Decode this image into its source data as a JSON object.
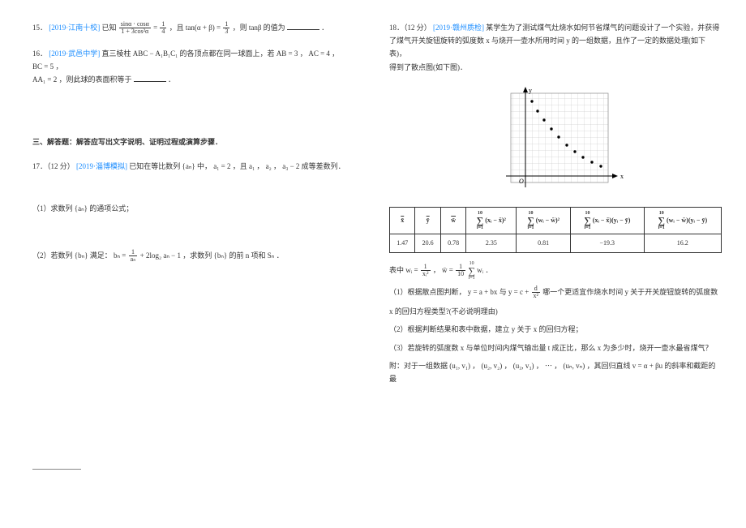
{
  "left": {
    "q15": {
      "num": "15．",
      "src": "[2019·江南十校]",
      "a": "已知 ",
      "frac_n": "sinα · cosα",
      "frac_d": "1 + 3cos²α",
      "eqA": " = ",
      "oneqA_n": "1",
      "oneqA_d": "4",
      "mid": " ，且 tan(α + β) = ",
      "oneqB_n": "1",
      "oneqB_d": "3",
      "tail": " ，则 tanβ 的值为",
      "end": "．"
    },
    "q16": {
      "num": "16．",
      "src": "[2019·武邑中学]",
      "a": "直三棱柱 ABC − A₁B₁C₁ 的各顶点都在同一球面上，若 AB = 3 ， AC = 4 ， BC = 5 ，",
      "b": "AA₁ = 2 ，则此球的表面积等于",
      "end": "．"
    },
    "section": "三、解答题：解答应写出文字说明、证明过程或演算步骤．",
    "q17": {
      "num": "17．（12 分）",
      "src": "[2019·淄博模拟]",
      "a": "已知在等比数列 {aₙ} 中， a₁ = 2 ，且 a₁ ， a₂ ， a₃ − 2 成等差数列．",
      "p1": "（1）求数列 {aₙ} 的通项公式；",
      "p2a": "（2）若数列 {bₙ} 满足： bₙ = ",
      "p2_n": "1",
      "p2_d": "aₙ",
      "p2b": " + 2log₂ aₙ − 1 ，求数列 {bₙ} 的前 n 项和 Sₙ ．"
    }
  },
  "right": {
    "q18": {
      "num": "18．（12 分）",
      "src": "[2019·赣州质检]",
      "a": "某学生为了测试煤气灶烧水如何节省煤气的问题设计了一个实验，并获得",
      "b": "了煤气开关旋钮旋转的弧度数 x 与烧开一壶水所用时间 y 的一组数据，且作了一定的数据处理(如下表)，",
      "c": "得到了散点图(如下图)．",
      "axis_x": "x",
      "axis_y": "y",
      "note_a": "表中 wᵢ = ",
      "note_f1n": "1",
      "note_f1d": "xᵢ²",
      "note_mid": " ，  w̄ = ",
      "note_f2n": "1",
      "note_f2d": "10",
      "note_sum_top": "10",
      "note_sum_bot": "i=1",
      "note_b": " wᵢ ．",
      "p1": "（1）根据散点图判断， y = a + bx 与 y = c + ",
      "p1_fn": "d",
      "p1_fd": "x²",
      "p1b": " 哪一个更适宜作烧水时间 y 关于开关旋钮旋转的弧度数",
      "p1c": "x 的回归方程类型?(不必说明理由)",
      "p2": "（2）根据判断结果和表中数据，建立 y 关于 x 的回归方程；",
      "p3": "（3）若旋转的弧度数 x 与单位时间内煤气输出量 t 成正比，那么 x 为多少时，烧开一壶水最省煤气？",
      "app": "附：对于一组数据 (u₁, v₁) ， (u₂, v₂) ， (u₃, v₃) ， ⋯ ， (uₙ, vₙ) ，其回归直线 v = α + βu 的斜率和截距的最"
    },
    "table": {
      "h1": "x̄",
      "h2": "ȳ",
      "h3": "w̄",
      "h4_top": "10",
      "h4_bot": "i=1",
      "h4_body": "(xᵢ − x̄)²",
      "h5_body": "(wᵢ − w̄)²",
      "h6_body": "(xᵢ − x̄)(yᵢ − ȳ)",
      "h7_body": "(wᵢ − w̄)(yᵢ − ȳ)",
      "r1": [
        "1.47",
        "20.6",
        "0.78",
        "2.35",
        "0.81",
        "−19.3",
        "16.2"
      ]
    }
  },
  "chart_data": {
    "type": "scatter",
    "title": "",
    "xlabel": "x",
    "ylabel": "y",
    "xlim": [
      0,
      3
    ],
    "ylim": [
      0,
      50
    ],
    "points": [
      [
        0.5,
        45
      ],
      [
        0.7,
        36
      ],
      [
        0.9,
        30
      ],
      [
        1.1,
        25
      ],
      [
        1.3,
        22
      ],
      [
        1.5,
        19
      ],
      [
        1.7,
        17
      ],
      [
        1.9,
        15
      ],
      [
        2.1,
        14
      ],
      [
        2.3,
        13
      ]
    ]
  }
}
